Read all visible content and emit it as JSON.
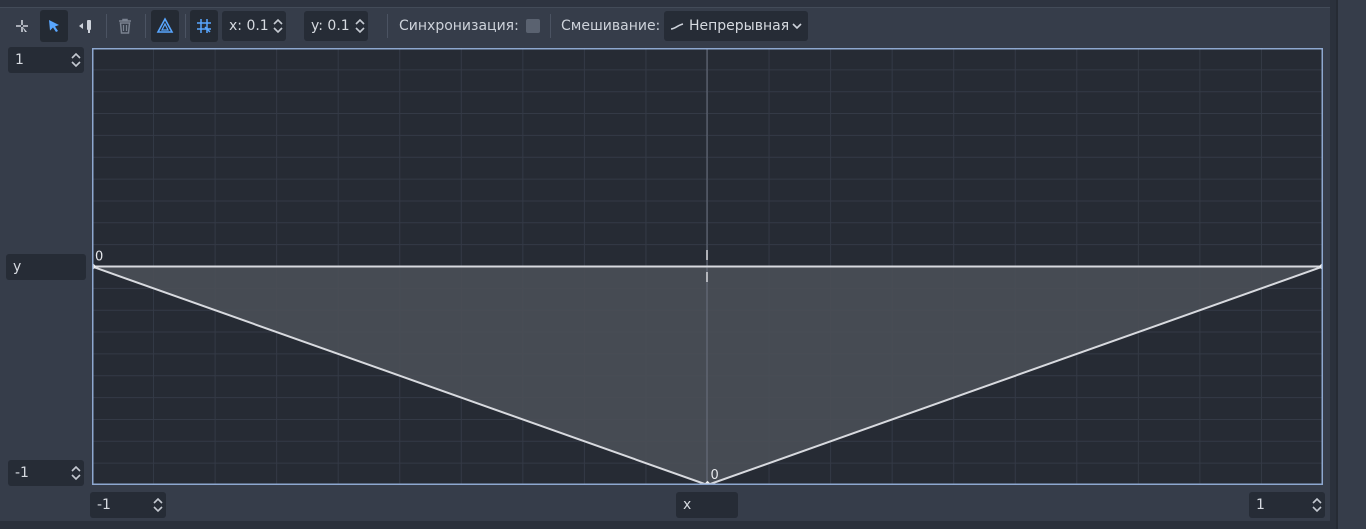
{
  "toolbar": {
    "snap_x": "x: 0.1",
    "snap_y": "y: 0.1",
    "sync_label": "Синхронизация:",
    "blend_label": "Смешивание:",
    "blend_value": "Непрерывная"
  },
  "axes": {
    "y_max": "1",
    "y_name": "y",
    "y_min": "-1",
    "x_min": "-1",
    "x_name": "x",
    "x_max": "1"
  },
  "points": [
    {
      "label": "0",
      "x": -1,
      "y": 0
    },
    {
      "label": "",
      "x": 1,
      "y": 0
    },
    {
      "label": "0",
      "x": 0,
      "y": -1
    }
  ],
  "colors": {
    "panel_bg": "#363d4a",
    "plot_bg": "#262b34",
    "grid": "#343a46",
    "plot_border": "#8ea8d0",
    "accent": "#58a6ff",
    "line": "#d8dadf"
  },
  "icons": {
    "create_point": "create-point-icon",
    "select": "select-arrow-icon",
    "create_triangle": "create-triangle-icon",
    "erase": "trash-icon",
    "show_triangles": "triangle-mesh-icon",
    "snap": "grid-snap-icon",
    "blend_curve": "curve-icon",
    "dropdown": "chevron-down-icon"
  }
}
